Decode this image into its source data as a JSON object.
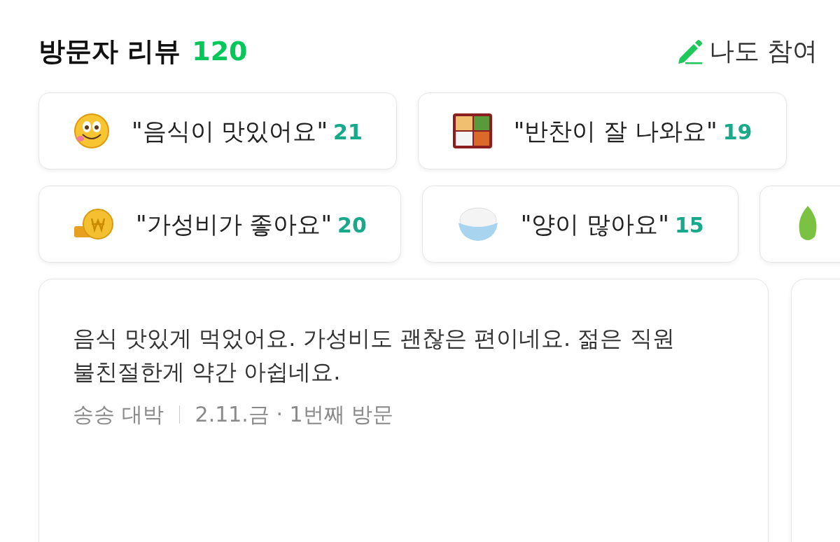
{
  "header": {
    "title": "방문자 리뷰",
    "count": "120",
    "action": "나도 참여"
  },
  "keyword_rows": [
    {
      "chips": [
        {
          "kind": "keyword",
          "label": "\"음식이 맛있어요\"",
          "count": "21"
        },
        {
          "kind": "keyword",
          "label": "\"반찬이 잘 나와요\"",
          "count": "19"
        }
      ]
    },
    {
      "chips": [
        {
          "kind": "keyword",
          "label": "\"가성비가 좋아요\"",
          "count": "20"
        },
        {
          "kind": "keyword",
          "label": "\"양이 많아요\"",
          "count": "15"
        },
        {
          "kind": "cropped"
        }
      ]
    }
  ],
  "reviews": [
    {
      "kind": "review",
      "text": "음식 맛있게 먹었어요. 가성비도 괜찮은 편이네요. 젊은 직원 불친절한게 약간 아쉽네요.",
      "author": "송송 대박",
      "visit": "2.11.금 · 1번째 방문"
    },
    {
      "kind": "cropped"
    }
  ]
}
